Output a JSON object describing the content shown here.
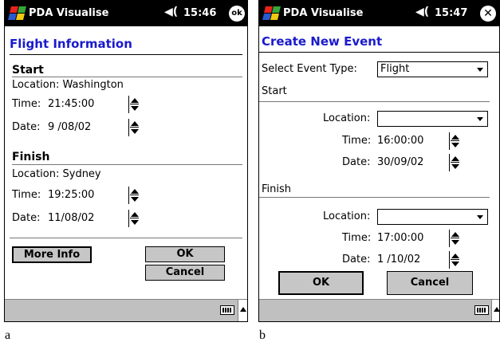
{
  "screen_a": {
    "app_title": "PDA Visualise",
    "clock": "15:46",
    "ok_label": "ok",
    "page_title": "Flight Information",
    "start": {
      "heading": "Start",
      "location": "Location: Washington",
      "time_label": "Time:",
      "time_value": "21:45:00",
      "date_label": "Date:",
      "date_value": "9 /08/02"
    },
    "finish": {
      "heading": "Finish",
      "location": "Location: Sydney",
      "time_label": "Time:",
      "time_value": "19:25:00",
      "date_label": "Date:",
      "date_value": "11/08/02"
    },
    "buttons": {
      "more_info": "More Info",
      "ok": "OK",
      "cancel": "Cancel"
    }
  },
  "screen_b": {
    "app_title": "PDA Visualise",
    "clock": "15:47",
    "page_title": "Create New Event",
    "event_type_label": "Select Event Type:",
    "event_type_value": "Flight",
    "start": {
      "heading": "Start",
      "location_label": "Location:",
      "location_value": "",
      "time_label": "Time:",
      "time_value": "16:00:00",
      "date_label": "Date:",
      "date_value": "30/09/02"
    },
    "finish": {
      "heading": "Finish",
      "location_label": "Location:",
      "location_value": "",
      "time_label": "Time:",
      "time_value": "17:00:00",
      "date_label": "Date:",
      "date_value": "1 /10/02"
    },
    "buttons": {
      "ok": "OK",
      "cancel": "Cancel"
    }
  },
  "captions": {
    "a": "a",
    "b": "b"
  },
  "colors": {
    "title_blue": "#1a1acd",
    "titlebar": "#000000",
    "button_grey": "#c6c6c6",
    "taskbar": "#c0c0c0"
  }
}
